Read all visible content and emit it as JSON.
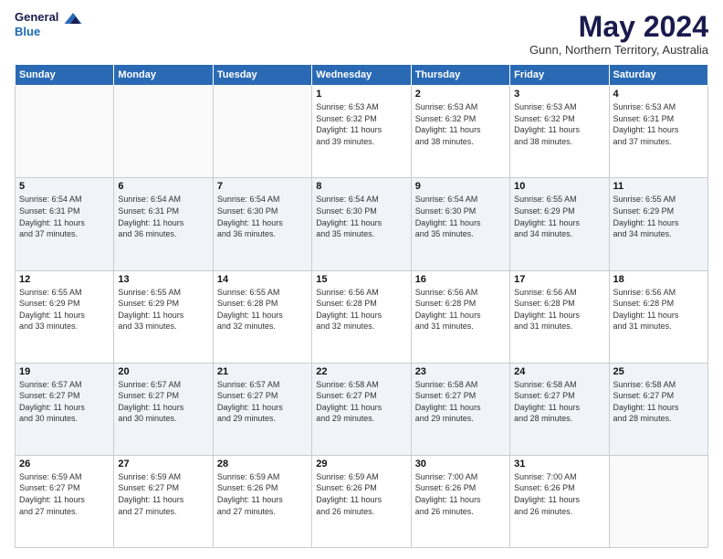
{
  "logo": {
    "line1": "General",
    "line2": "Blue"
  },
  "title": "May 2024",
  "subtitle": "Gunn, Northern Territory, Australia",
  "days_of_week": [
    "Sunday",
    "Monday",
    "Tuesday",
    "Wednesday",
    "Thursday",
    "Friday",
    "Saturday"
  ],
  "weeks": [
    [
      {
        "day": "",
        "info": ""
      },
      {
        "day": "",
        "info": ""
      },
      {
        "day": "",
        "info": ""
      },
      {
        "day": "1",
        "info": "Sunrise: 6:53 AM\nSunset: 6:32 PM\nDaylight: 11 hours\nand 39 minutes."
      },
      {
        "day": "2",
        "info": "Sunrise: 6:53 AM\nSunset: 6:32 PM\nDaylight: 11 hours\nand 38 minutes."
      },
      {
        "day": "3",
        "info": "Sunrise: 6:53 AM\nSunset: 6:32 PM\nDaylight: 11 hours\nand 38 minutes."
      },
      {
        "day": "4",
        "info": "Sunrise: 6:53 AM\nSunset: 6:31 PM\nDaylight: 11 hours\nand 37 minutes."
      }
    ],
    [
      {
        "day": "5",
        "info": "Sunrise: 6:54 AM\nSunset: 6:31 PM\nDaylight: 11 hours\nand 37 minutes."
      },
      {
        "day": "6",
        "info": "Sunrise: 6:54 AM\nSunset: 6:31 PM\nDaylight: 11 hours\nand 36 minutes."
      },
      {
        "day": "7",
        "info": "Sunrise: 6:54 AM\nSunset: 6:30 PM\nDaylight: 11 hours\nand 36 minutes."
      },
      {
        "day": "8",
        "info": "Sunrise: 6:54 AM\nSunset: 6:30 PM\nDaylight: 11 hours\nand 35 minutes."
      },
      {
        "day": "9",
        "info": "Sunrise: 6:54 AM\nSunset: 6:30 PM\nDaylight: 11 hours\nand 35 minutes."
      },
      {
        "day": "10",
        "info": "Sunrise: 6:55 AM\nSunset: 6:29 PM\nDaylight: 11 hours\nand 34 minutes."
      },
      {
        "day": "11",
        "info": "Sunrise: 6:55 AM\nSunset: 6:29 PM\nDaylight: 11 hours\nand 34 minutes."
      }
    ],
    [
      {
        "day": "12",
        "info": "Sunrise: 6:55 AM\nSunset: 6:29 PM\nDaylight: 11 hours\nand 33 minutes."
      },
      {
        "day": "13",
        "info": "Sunrise: 6:55 AM\nSunset: 6:29 PM\nDaylight: 11 hours\nand 33 minutes."
      },
      {
        "day": "14",
        "info": "Sunrise: 6:55 AM\nSunset: 6:28 PM\nDaylight: 11 hours\nand 32 minutes."
      },
      {
        "day": "15",
        "info": "Sunrise: 6:56 AM\nSunset: 6:28 PM\nDaylight: 11 hours\nand 32 minutes."
      },
      {
        "day": "16",
        "info": "Sunrise: 6:56 AM\nSunset: 6:28 PM\nDaylight: 11 hours\nand 31 minutes."
      },
      {
        "day": "17",
        "info": "Sunrise: 6:56 AM\nSunset: 6:28 PM\nDaylight: 11 hours\nand 31 minutes."
      },
      {
        "day": "18",
        "info": "Sunrise: 6:56 AM\nSunset: 6:28 PM\nDaylight: 11 hours\nand 31 minutes."
      }
    ],
    [
      {
        "day": "19",
        "info": "Sunrise: 6:57 AM\nSunset: 6:27 PM\nDaylight: 11 hours\nand 30 minutes."
      },
      {
        "day": "20",
        "info": "Sunrise: 6:57 AM\nSunset: 6:27 PM\nDaylight: 11 hours\nand 30 minutes."
      },
      {
        "day": "21",
        "info": "Sunrise: 6:57 AM\nSunset: 6:27 PM\nDaylight: 11 hours\nand 29 minutes."
      },
      {
        "day": "22",
        "info": "Sunrise: 6:58 AM\nSunset: 6:27 PM\nDaylight: 11 hours\nand 29 minutes."
      },
      {
        "day": "23",
        "info": "Sunrise: 6:58 AM\nSunset: 6:27 PM\nDaylight: 11 hours\nand 29 minutes."
      },
      {
        "day": "24",
        "info": "Sunrise: 6:58 AM\nSunset: 6:27 PM\nDaylight: 11 hours\nand 28 minutes."
      },
      {
        "day": "25",
        "info": "Sunrise: 6:58 AM\nSunset: 6:27 PM\nDaylight: 11 hours\nand 28 minutes."
      }
    ],
    [
      {
        "day": "26",
        "info": "Sunrise: 6:59 AM\nSunset: 6:27 PM\nDaylight: 11 hours\nand 27 minutes."
      },
      {
        "day": "27",
        "info": "Sunrise: 6:59 AM\nSunset: 6:27 PM\nDaylight: 11 hours\nand 27 minutes."
      },
      {
        "day": "28",
        "info": "Sunrise: 6:59 AM\nSunset: 6:26 PM\nDaylight: 11 hours\nand 27 minutes."
      },
      {
        "day": "29",
        "info": "Sunrise: 6:59 AM\nSunset: 6:26 PM\nDaylight: 11 hours\nand 26 minutes."
      },
      {
        "day": "30",
        "info": "Sunrise: 7:00 AM\nSunset: 6:26 PM\nDaylight: 11 hours\nand 26 minutes."
      },
      {
        "day": "31",
        "info": "Sunrise: 7:00 AM\nSunset: 6:26 PM\nDaylight: 11 hours\nand 26 minutes."
      },
      {
        "day": "",
        "info": ""
      }
    ]
  ]
}
